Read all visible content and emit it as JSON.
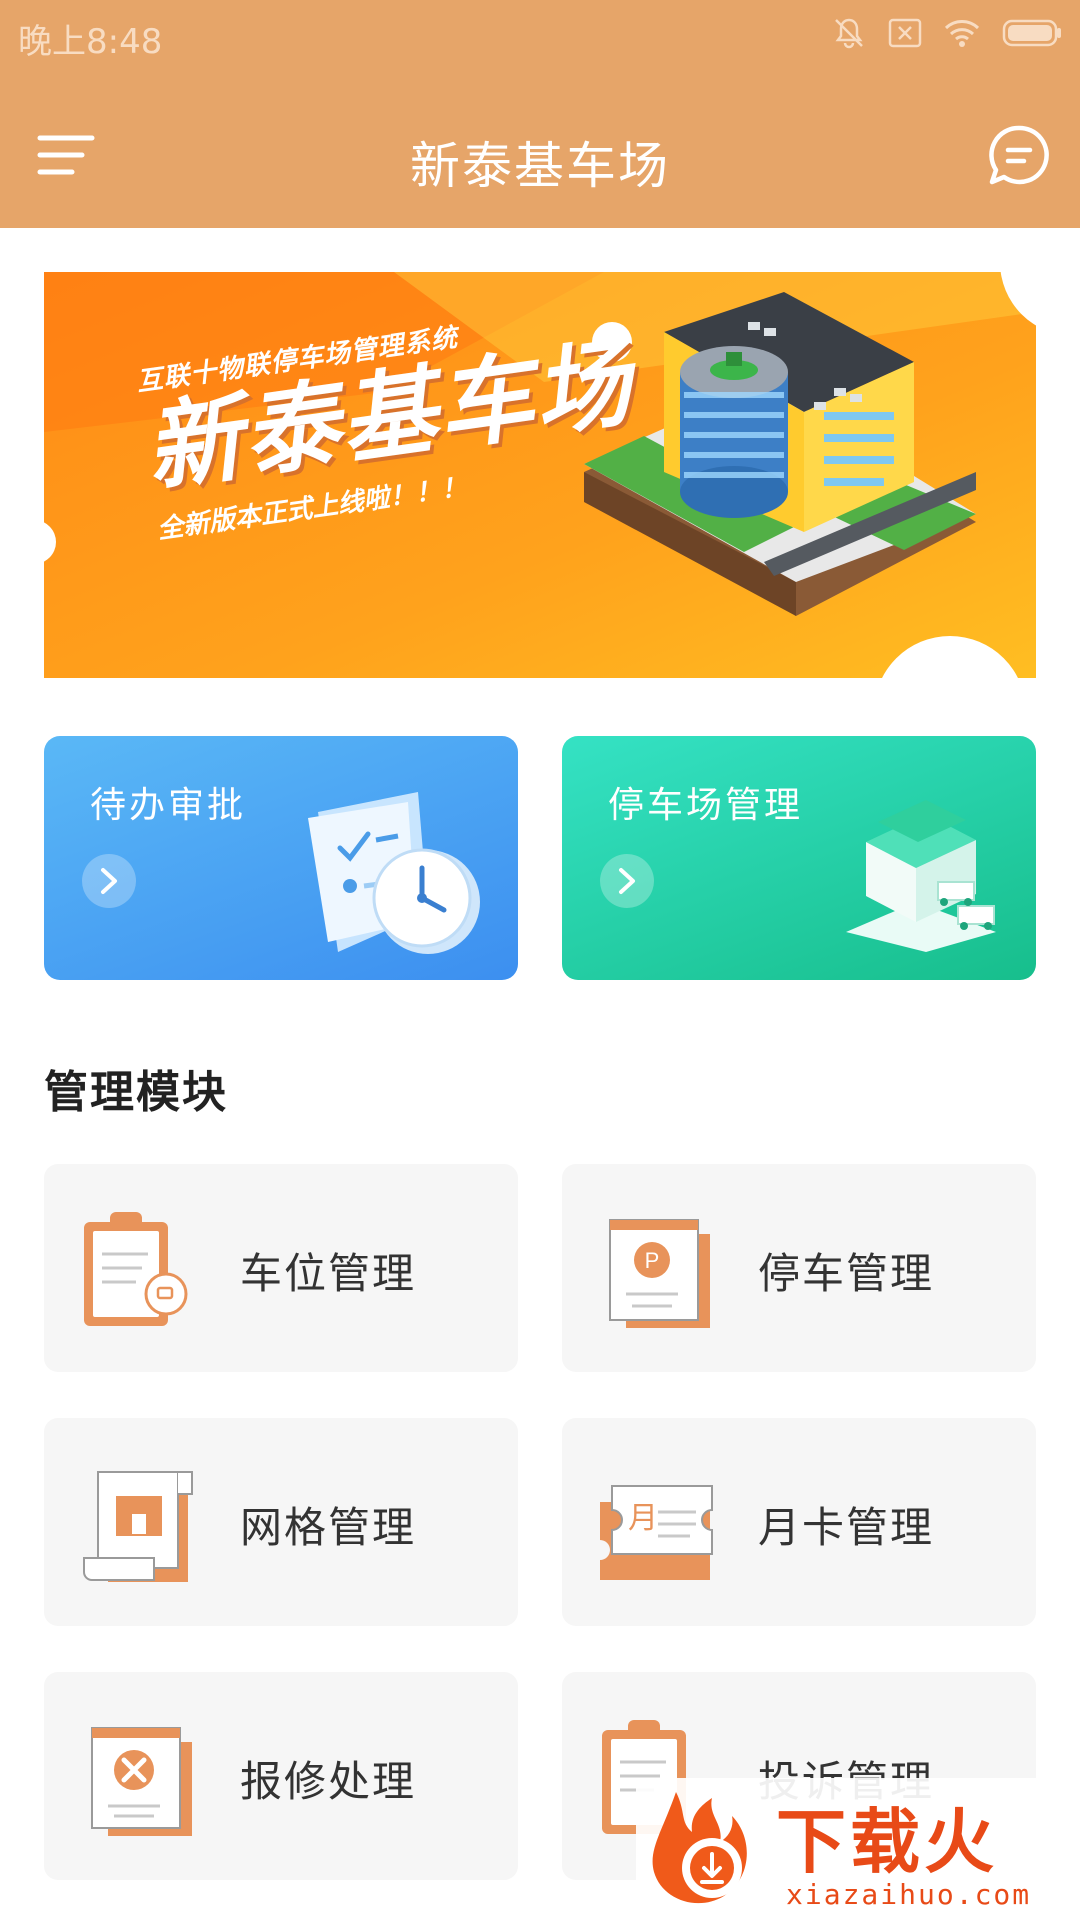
{
  "status_bar": {
    "time": "晚上8:48"
  },
  "header": {
    "title": "新泰基车场"
  },
  "banner": {
    "subtitle": "互联十物联停车场管理系统",
    "headline": "新泰基车场",
    "tagline": "全新版本正式上线啦！！！"
  },
  "quick_cards": [
    {
      "label": "待办审批"
    },
    {
      "label": "停车场管理"
    }
  ],
  "section": {
    "title": "管理模块"
  },
  "modules": [
    {
      "label": "车位管理"
    },
    {
      "label": "停车管理"
    },
    {
      "label": "网格管理"
    },
    {
      "label": "月卡管理",
      "icon_text": "月"
    },
    {
      "label": "报修处理"
    },
    {
      "label": "投诉管理"
    }
  ],
  "watermark": {
    "brand": "下载火",
    "url": "xiazaihuo.com"
  },
  "colors": {
    "header": "#e6a569",
    "accent": "#e8935a",
    "blue_card": "#3c8ff0",
    "green_card": "#17be8c",
    "tile_bg": "#f6f6f6"
  }
}
